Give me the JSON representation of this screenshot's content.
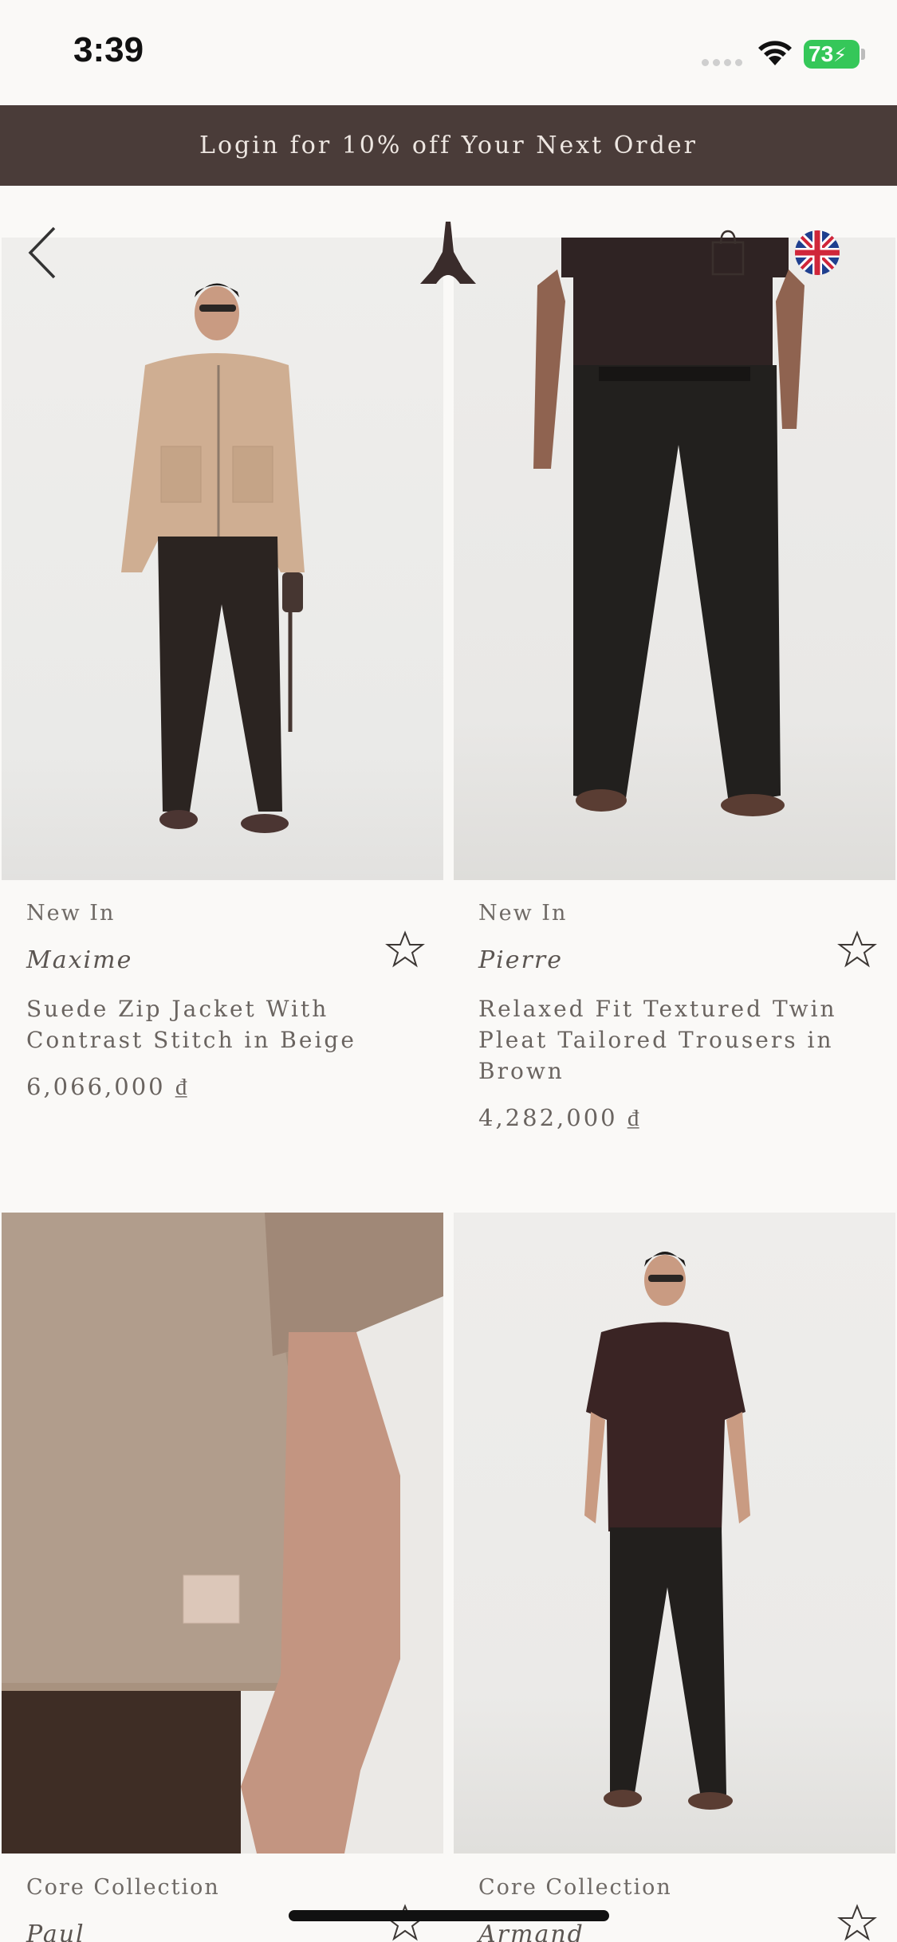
{
  "status_bar": {
    "time": "3:39",
    "battery": "73"
  },
  "banner": {
    "text": "Login for 10% off Your Next Order"
  },
  "header": {
    "back_icon": "chevron-left-icon",
    "logo": "eiffel-tower-logo",
    "bag_icon": "shopping-bag-icon",
    "language_flag": "uk-flag-icon"
  },
  "products": [
    {
      "tag": "New In",
      "brand": "Maxime",
      "name": "Suede Zip Jacket With Contrast Stitch in Beige",
      "price": "6,066,000 ₫"
    },
    {
      "tag": "New In",
      "brand": "Pierre",
      "name": "Relaxed Fit Textured Twin Pleat Tailored Trousers in Brown",
      "price": "4,282,000 ₫"
    },
    {
      "tag": "Core Collection",
      "brand": "Paul",
      "name": "",
      "price": ""
    },
    {
      "tag": "Core Collection",
      "brand": "Armand",
      "name": "",
      "price": ""
    }
  ],
  "colors": {
    "banner_bg": "#4a3c39",
    "page_bg": "#faf9f7",
    "battery": "#35c759"
  }
}
